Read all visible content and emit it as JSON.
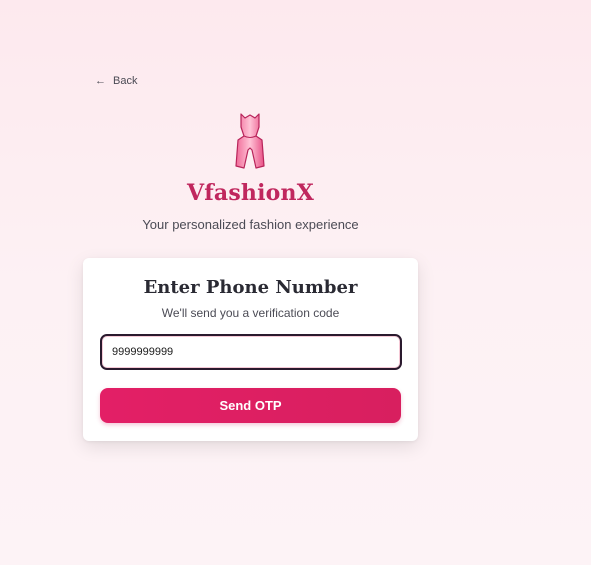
{
  "nav": {
    "back_label": "Back"
  },
  "brand": {
    "name": "VfashionX",
    "tagline": "Your personalized fashion experience",
    "logo_icon": "dress-icon",
    "accent_color": "#c0275e"
  },
  "form": {
    "title": "Enter Phone Number",
    "subtitle": "We'll send you a verification code",
    "phone_value": "9999999999",
    "submit_label": "Send OTP",
    "button_color": "#e31f66"
  }
}
